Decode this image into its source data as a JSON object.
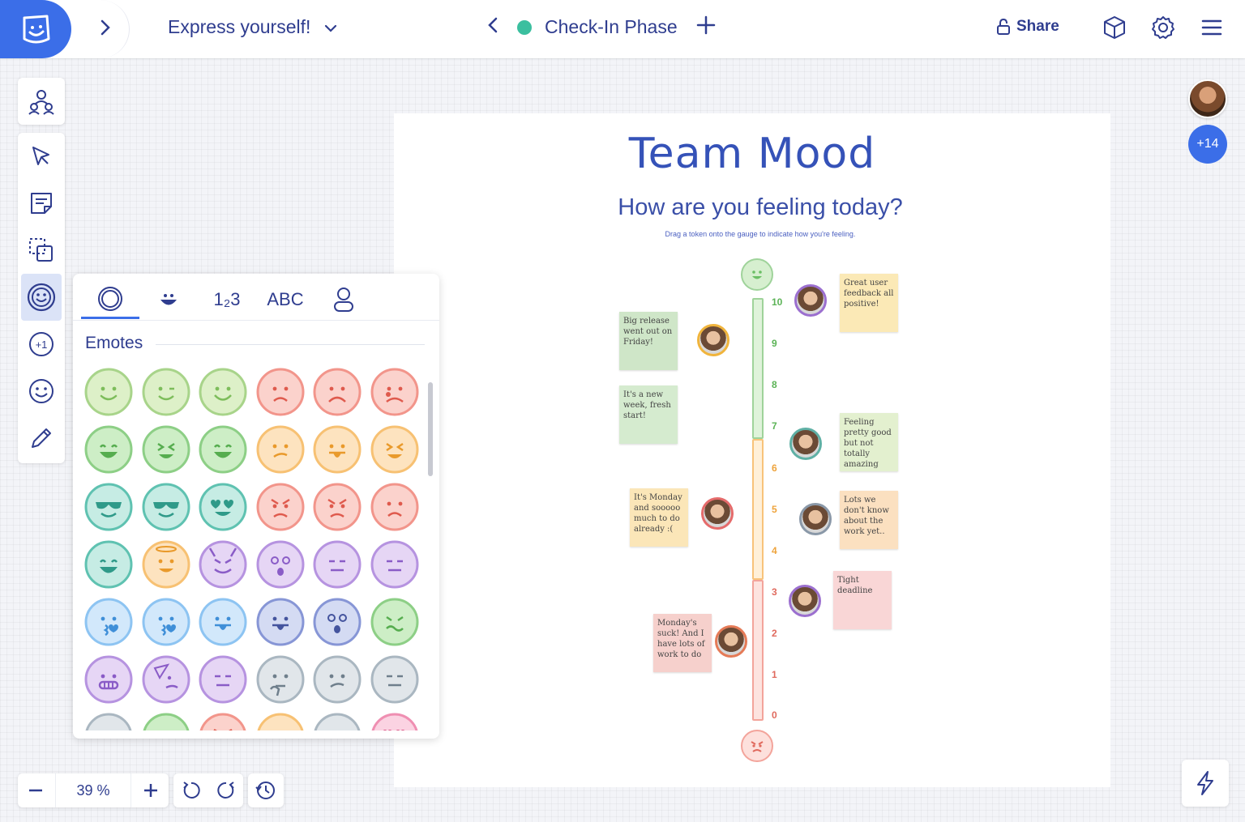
{
  "header": {
    "board_title": "Express yourself!",
    "phase_name": "Check-In Phase",
    "share_label": "Share"
  },
  "collaborators": {
    "more_count": "+14"
  },
  "board": {
    "title": "Team Mood",
    "subtitle": "How are you feeling today?",
    "hint": "Drag a token onto the gauge to indicate how you're feeling.",
    "gauge_levels": [
      "10",
      "9",
      "8",
      "7",
      "6",
      "5",
      "4",
      "3",
      "2",
      "1",
      "0"
    ],
    "notes": [
      {
        "text": "Big release went out on Friday!",
        "color": "#cfe6c8"
      },
      {
        "text": "It's a new week, fresh start!",
        "color": "#d5ebcf"
      },
      {
        "text": "It's Monday and sooooo much to do already :(",
        "color": "#fbe6b8"
      },
      {
        "text": "Monday's suck! And I have lots of work to do",
        "color": "#f6d0cc"
      },
      {
        "text": "Great user feedback all positive!",
        "color": "#fbe9b6"
      },
      {
        "text": "Feeling pretty good but not totally amazing",
        "color": "#e3f0cf"
      },
      {
        "text": "Lots we don't know about the work yet..",
        "color": "#fbe0c0"
      },
      {
        "text": "Tight deadline",
        "color": "#f9d6d6"
      }
    ]
  },
  "emote_panel": {
    "tabs": [
      "O",
      "◡",
      "1₂3",
      "ABC",
      "♙"
    ],
    "heading": "Emotes"
  },
  "zoom": {
    "value": "39 %"
  },
  "colors": {
    "accent": "#3b6ee8",
    "gauge_green": "#9fd39a",
    "gauge_orange": "#f8c37a",
    "gauge_red": "#f3a49b"
  }
}
